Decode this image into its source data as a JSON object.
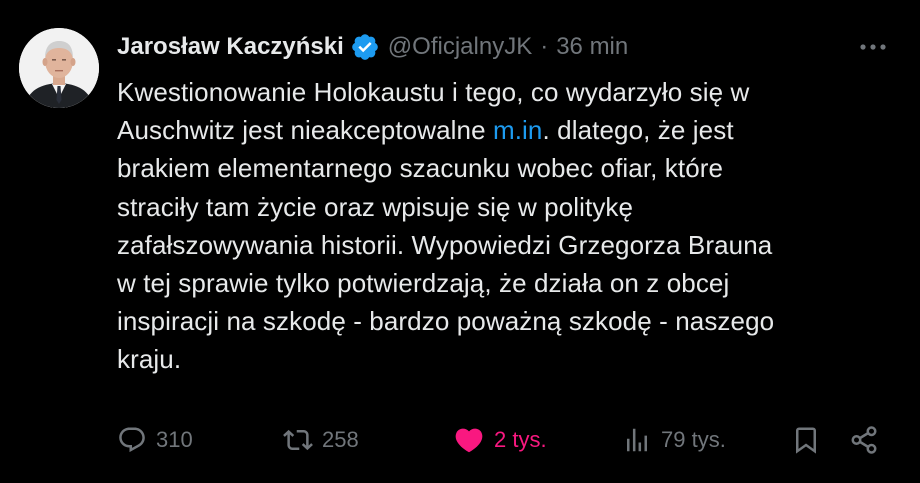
{
  "tweet": {
    "author": {
      "name": "Jarosław Kaczyński",
      "handle": "@OficjalnyJK",
      "verified": true
    },
    "separator": "·",
    "timestamp": "36 min",
    "text_before_link": "Kwestionowanie Holokaustu i tego, co wydarzyło się w\nAuschwitz jest nieakceptowalne ",
    "link_text": "m.in",
    "text_after_link": ". dlatego, że jest\nbrakiem elementarnego szacunku wobec ofiar, które\nstraciły tam życie oraz wpisuje się w politykę\nzafałszowywania historii. Wypowiedzi Grzegorza Brauna\nw tej sprawie tylko potwierdzają, że działa on z obcej\ninspiracji na szkodę - bardzo poważną szkodę - naszego\nkraju."
  },
  "actions": {
    "replies": "310",
    "retweets": "258",
    "likes": "2 tys.",
    "views": "79 tys."
  },
  "icons": {
    "more": "more-horizontal-icon",
    "verified": "verified-badge-icon",
    "reply": "reply-icon",
    "retweet": "retweet-icon",
    "like": "heart-icon",
    "views": "views-icon",
    "bookmark": "bookmark-icon",
    "share": "share-icon"
  },
  "colors": {
    "background": "#000000",
    "text": "#e7e9ea",
    "muted": "#71767b",
    "link": "#1d9bf0",
    "like_active": "#f91880",
    "verified": "#1d9bf0"
  }
}
